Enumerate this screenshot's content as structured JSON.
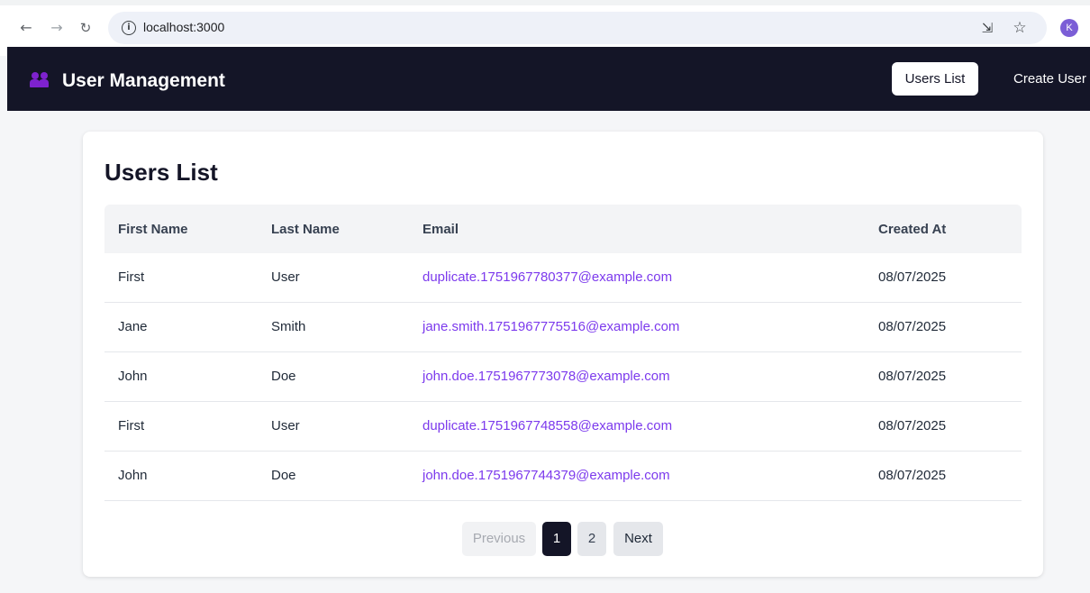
{
  "browser": {
    "url": "localhost:3000",
    "profile_initial": "K"
  },
  "header": {
    "title": "User Management",
    "nav": {
      "users_list": "Users List",
      "create_user": "Create User"
    }
  },
  "main": {
    "title": "Users List",
    "columns": [
      "First Name",
      "Last Name",
      "Email",
      "Created At"
    ],
    "rows": [
      {
        "first_name": "First",
        "last_name": "User",
        "email": "duplicate.1751967780377@example.com",
        "created_at": "08/07/2025"
      },
      {
        "first_name": "Jane",
        "last_name": "Smith",
        "email": "jane.smith.1751967775516@example.com",
        "created_at": "08/07/2025"
      },
      {
        "first_name": "John",
        "last_name": "Doe",
        "email": "john.doe.1751967773078@example.com",
        "created_at": "08/07/2025"
      },
      {
        "first_name": "First",
        "last_name": "User",
        "email": "duplicate.1751967748558@example.com",
        "created_at": "08/07/2025"
      },
      {
        "first_name": "John",
        "last_name": "Doe",
        "email": "john.doe.1751967744379@example.com",
        "created_at": "08/07/2025"
      }
    ]
  },
  "pagination": {
    "previous": "Previous",
    "pages": [
      "1",
      "2"
    ],
    "current_page": "1",
    "next": "Next"
  },
  "colors": {
    "header_bg": "#141527",
    "link": "#7c3aed",
    "brand_icon": "#7e22ce"
  }
}
